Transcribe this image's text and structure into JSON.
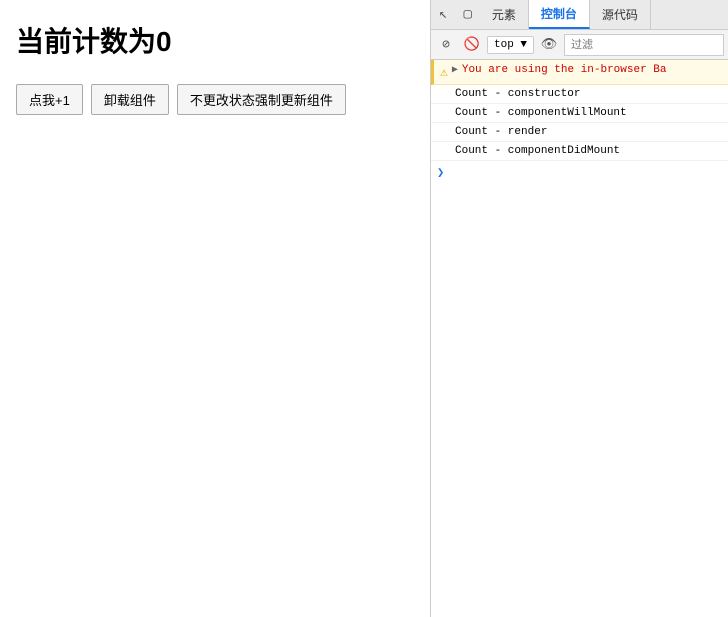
{
  "left": {
    "title": "当前计数为0",
    "buttons": [
      {
        "id": "increment",
        "label": "点我+1"
      },
      {
        "id": "unmount",
        "label": "卸载组件"
      },
      {
        "id": "force-update",
        "label": "不更改状态强制更新组件"
      }
    ]
  },
  "devtools": {
    "tabs": [
      {
        "id": "elements",
        "label": "元素"
      },
      {
        "id": "console",
        "label": "控制台",
        "active": true
      },
      {
        "id": "sources",
        "label": "源代码"
      }
    ],
    "tab_icons": [
      {
        "id": "cursor",
        "symbol": "↖"
      },
      {
        "id": "device",
        "symbol": "⬜"
      }
    ],
    "toolbar": {
      "icons": [
        {
          "id": "clear",
          "symbol": "⊘"
        },
        {
          "id": "block",
          "symbol": "🚫"
        }
      ],
      "top_selector": "top ▼",
      "eye_icon": "👁",
      "filter_placeholder": "过滤"
    },
    "console_logs": {
      "warning": {
        "icon": "⚠",
        "expand_icon": "▶",
        "text": "You are using the in-browser Ba"
      },
      "log_entries": [
        "Count - constructor",
        "Count - componentWillMount",
        "Count - render",
        "Count - componentDidMount"
      ]
    }
  }
}
